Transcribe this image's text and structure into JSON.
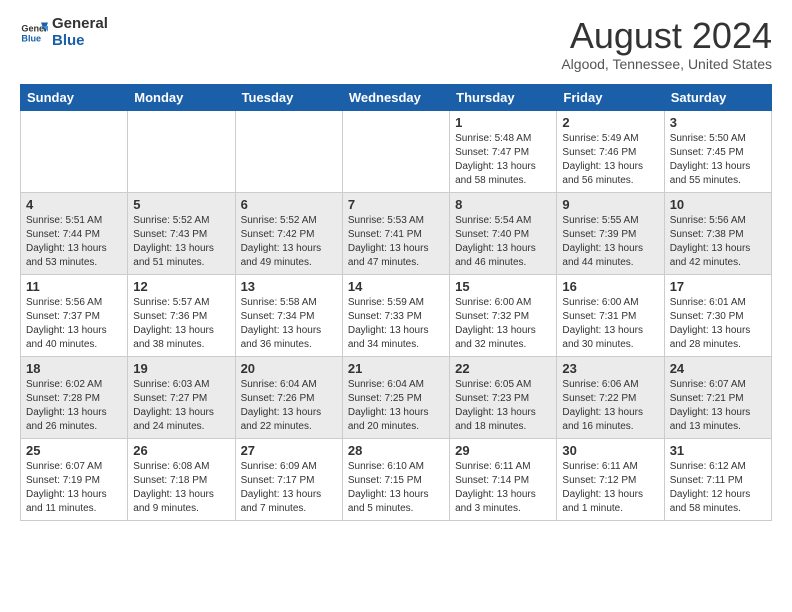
{
  "header": {
    "logo_general": "General",
    "logo_blue": "Blue",
    "month_title": "August 2024",
    "subtitle": "Algood, Tennessee, United States"
  },
  "calendar": {
    "days_of_week": [
      "Sunday",
      "Monday",
      "Tuesday",
      "Wednesday",
      "Thursday",
      "Friday",
      "Saturday"
    ],
    "weeks": [
      [
        {
          "day": "",
          "info": ""
        },
        {
          "day": "",
          "info": ""
        },
        {
          "day": "",
          "info": ""
        },
        {
          "day": "",
          "info": ""
        },
        {
          "day": "1",
          "info": "Sunrise: 5:48 AM\nSunset: 7:47 PM\nDaylight: 13 hours\nand 58 minutes."
        },
        {
          "day": "2",
          "info": "Sunrise: 5:49 AM\nSunset: 7:46 PM\nDaylight: 13 hours\nand 56 minutes."
        },
        {
          "day": "3",
          "info": "Sunrise: 5:50 AM\nSunset: 7:45 PM\nDaylight: 13 hours\nand 55 minutes."
        }
      ],
      [
        {
          "day": "4",
          "info": "Sunrise: 5:51 AM\nSunset: 7:44 PM\nDaylight: 13 hours\nand 53 minutes."
        },
        {
          "day": "5",
          "info": "Sunrise: 5:52 AM\nSunset: 7:43 PM\nDaylight: 13 hours\nand 51 minutes."
        },
        {
          "day": "6",
          "info": "Sunrise: 5:52 AM\nSunset: 7:42 PM\nDaylight: 13 hours\nand 49 minutes."
        },
        {
          "day": "7",
          "info": "Sunrise: 5:53 AM\nSunset: 7:41 PM\nDaylight: 13 hours\nand 47 minutes."
        },
        {
          "day": "8",
          "info": "Sunrise: 5:54 AM\nSunset: 7:40 PM\nDaylight: 13 hours\nand 46 minutes."
        },
        {
          "day": "9",
          "info": "Sunrise: 5:55 AM\nSunset: 7:39 PM\nDaylight: 13 hours\nand 44 minutes."
        },
        {
          "day": "10",
          "info": "Sunrise: 5:56 AM\nSunset: 7:38 PM\nDaylight: 13 hours\nand 42 minutes."
        }
      ],
      [
        {
          "day": "11",
          "info": "Sunrise: 5:56 AM\nSunset: 7:37 PM\nDaylight: 13 hours\nand 40 minutes."
        },
        {
          "day": "12",
          "info": "Sunrise: 5:57 AM\nSunset: 7:36 PM\nDaylight: 13 hours\nand 38 minutes."
        },
        {
          "day": "13",
          "info": "Sunrise: 5:58 AM\nSunset: 7:34 PM\nDaylight: 13 hours\nand 36 minutes."
        },
        {
          "day": "14",
          "info": "Sunrise: 5:59 AM\nSunset: 7:33 PM\nDaylight: 13 hours\nand 34 minutes."
        },
        {
          "day": "15",
          "info": "Sunrise: 6:00 AM\nSunset: 7:32 PM\nDaylight: 13 hours\nand 32 minutes."
        },
        {
          "day": "16",
          "info": "Sunrise: 6:00 AM\nSunset: 7:31 PM\nDaylight: 13 hours\nand 30 minutes."
        },
        {
          "day": "17",
          "info": "Sunrise: 6:01 AM\nSunset: 7:30 PM\nDaylight: 13 hours\nand 28 minutes."
        }
      ],
      [
        {
          "day": "18",
          "info": "Sunrise: 6:02 AM\nSunset: 7:28 PM\nDaylight: 13 hours\nand 26 minutes."
        },
        {
          "day": "19",
          "info": "Sunrise: 6:03 AM\nSunset: 7:27 PM\nDaylight: 13 hours\nand 24 minutes."
        },
        {
          "day": "20",
          "info": "Sunrise: 6:04 AM\nSunset: 7:26 PM\nDaylight: 13 hours\nand 22 minutes."
        },
        {
          "day": "21",
          "info": "Sunrise: 6:04 AM\nSunset: 7:25 PM\nDaylight: 13 hours\nand 20 minutes."
        },
        {
          "day": "22",
          "info": "Sunrise: 6:05 AM\nSunset: 7:23 PM\nDaylight: 13 hours\nand 18 minutes."
        },
        {
          "day": "23",
          "info": "Sunrise: 6:06 AM\nSunset: 7:22 PM\nDaylight: 13 hours\nand 16 minutes."
        },
        {
          "day": "24",
          "info": "Sunrise: 6:07 AM\nSunset: 7:21 PM\nDaylight: 13 hours\nand 13 minutes."
        }
      ],
      [
        {
          "day": "25",
          "info": "Sunrise: 6:07 AM\nSunset: 7:19 PM\nDaylight: 13 hours\nand 11 minutes."
        },
        {
          "day": "26",
          "info": "Sunrise: 6:08 AM\nSunset: 7:18 PM\nDaylight: 13 hours\nand 9 minutes."
        },
        {
          "day": "27",
          "info": "Sunrise: 6:09 AM\nSunset: 7:17 PM\nDaylight: 13 hours\nand 7 minutes."
        },
        {
          "day": "28",
          "info": "Sunrise: 6:10 AM\nSunset: 7:15 PM\nDaylight: 13 hours\nand 5 minutes."
        },
        {
          "day": "29",
          "info": "Sunrise: 6:11 AM\nSunset: 7:14 PM\nDaylight: 13 hours\nand 3 minutes."
        },
        {
          "day": "30",
          "info": "Sunrise: 6:11 AM\nSunset: 7:12 PM\nDaylight: 13 hours\nand 1 minute."
        },
        {
          "day": "31",
          "info": "Sunrise: 6:12 AM\nSunset: 7:11 PM\nDaylight: 12 hours\nand 58 minutes."
        }
      ]
    ]
  }
}
